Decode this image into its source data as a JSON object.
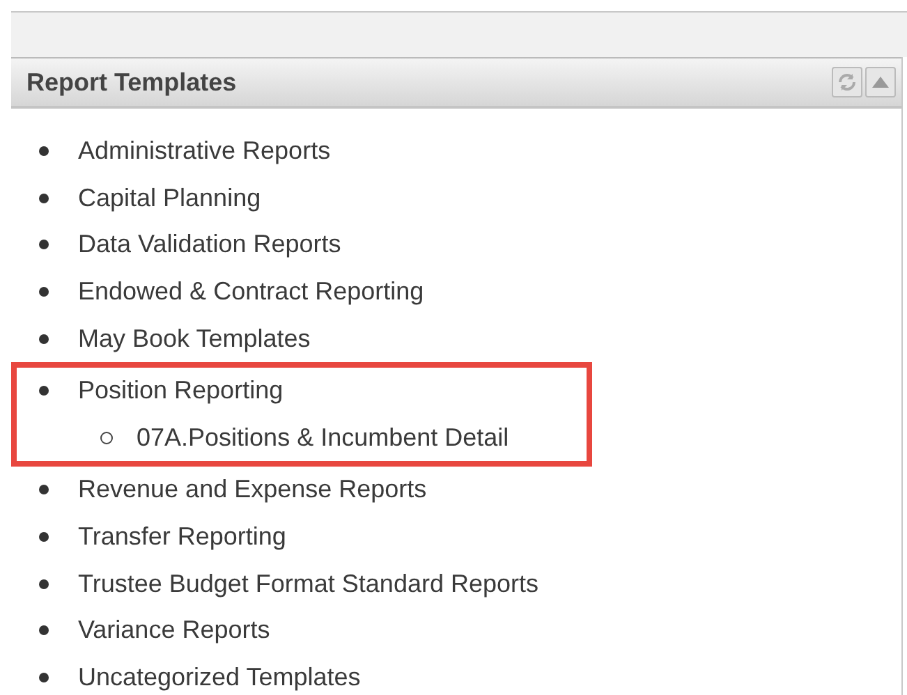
{
  "panel": {
    "title": "Report Templates"
  },
  "items": [
    {
      "label": "Administrative Reports",
      "highlighted": false
    },
    {
      "label": "Capital Planning",
      "highlighted": false
    },
    {
      "label": "Data Validation Reports",
      "highlighted": false
    },
    {
      "label": "Endowed & Contract Reporting",
      "highlighted": false
    },
    {
      "label": "May Book Templates",
      "highlighted": false
    },
    {
      "label": "Position Reporting",
      "highlighted": true,
      "children": [
        {
          "label": "07A.Positions & Incumbent Detail"
        }
      ]
    },
    {
      "label": "Revenue and Expense Reports",
      "highlighted": false
    },
    {
      "label": "Transfer Reporting",
      "highlighted": false
    },
    {
      "label": "Trustee Budget Format Standard Reports",
      "highlighted": false
    },
    {
      "label": "Variance Reports",
      "highlighted": false
    },
    {
      "label": "Uncategorized Templates",
      "highlighted": false
    }
  ]
}
